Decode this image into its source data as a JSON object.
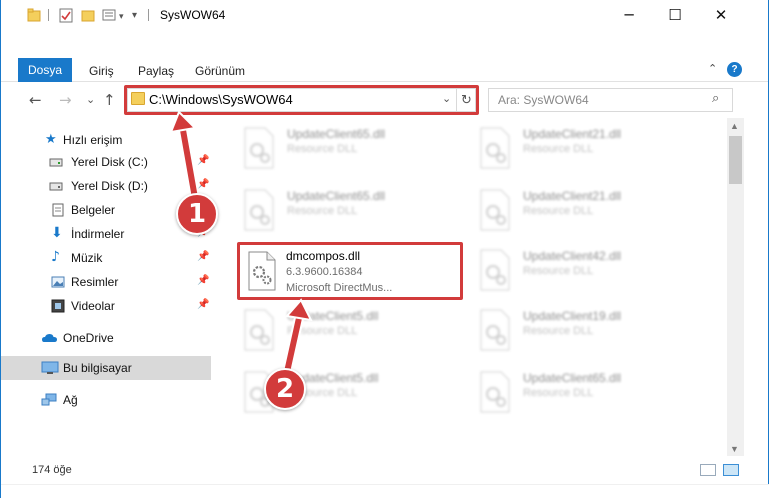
{
  "window": {
    "title": "SysWOW64",
    "minimize_glyph": "─",
    "maximize_glyph": "☐",
    "close_glyph": "✕"
  },
  "ribbon": {
    "tabs": [
      "Dosya",
      "Giriş",
      "Paylaş",
      "Görünüm"
    ],
    "collapse_glyph": "⌃",
    "help_glyph": "?"
  },
  "navigation": {
    "back_glyph": "←",
    "forward_glyph": "→",
    "recent_glyph": "⌄",
    "up_glyph": "↑",
    "address_path": "C:\\Windows\\SysWOW64",
    "address_dropdown_glyph": "⌄",
    "refresh_glyph": "↻",
    "search_placeholder": "Ara: SysWOW64",
    "search_glyph": "⌕"
  },
  "sidebar": {
    "items": [
      {
        "label": "Hızlı erişim",
        "icon": "star-icon",
        "pinned": false
      },
      {
        "label": "Yerel Disk (C:)",
        "icon": "drive-icon",
        "pinned": true
      },
      {
        "label": "Yerel Disk (D:)",
        "icon": "drive-icon",
        "pinned": true
      },
      {
        "label": "Belgeler",
        "icon": "document-icon",
        "pinned": true
      },
      {
        "label": "İndirmeler",
        "icon": "download-icon",
        "pinned": true
      },
      {
        "label": "Müzik",
        "icon": "music-icon",
        "pinned": true
      },
      {
        "label": "Resimler",
        "icon": "pictures-icon",
        "pinned": true
      },
      {
        "label": "Videolar",
        "icon": "video-icon",
        "pinned": true
      },
      {
        "label": "OneDrive",
        "icon": "cloud-icon",
        "pinned": false
      },
      {
        "label": "Bu bilgisayar",
        "icon": "computer-icon",
        "pinned": false
      },
      {
        "label": "Ağ",
        "icon": "network-icon",
        "pinned": false
      }
    ],
    "pin_glyph": "📌"
  },
  "files": {
    "highlighted": {
      "name": "dmcompos.dll",
      "version": "6.3.9600.16384",
      "description": "Microsoft DirectMus..."
    },
    "left_column": [
      {
        "name": "UpdateClient65.dll",
        "type": "Resource DLL"
      },
      {
        "name": "UpdateClient65.dll",
        "type": "Resource DLL"
      },
      {
        "name": "UpdateClient5.dll",
        "type": "Resource DLL"
      },
      {
        "name": "UpdateClient5.dll",
        "type": "Resource DLL"
      }
    ],
    "right_column": [
      {
        "name": "UpdateClient21.dll",
        "type": "Resource DLL"
      },
      {
        "name": "UpdateClient21.dll",
        "type": "Resource DLL"
      },
      {
        "name": "UpdateClient42.dll",
        "type": "Resource DLL"
      },
      {
        "name": "UpdateClient19.dll",
        "type": "Resource DLL"
      },
      {
        "name": "UpdateClient65.dll",
        "type": "Resource DLL"
      }
    ]
  },
  "status": {
    "item_count": "174 öğe"
  },
  "annotations": {
    "step1": "1",
    "step2": "2",
    "color": "#d23b3b"
  },
  "colors": {
    "accent": "#1979ca",
    "highlight": "#d23b3b",
    "selected_nav": "#d9d9d9"
  }
}
